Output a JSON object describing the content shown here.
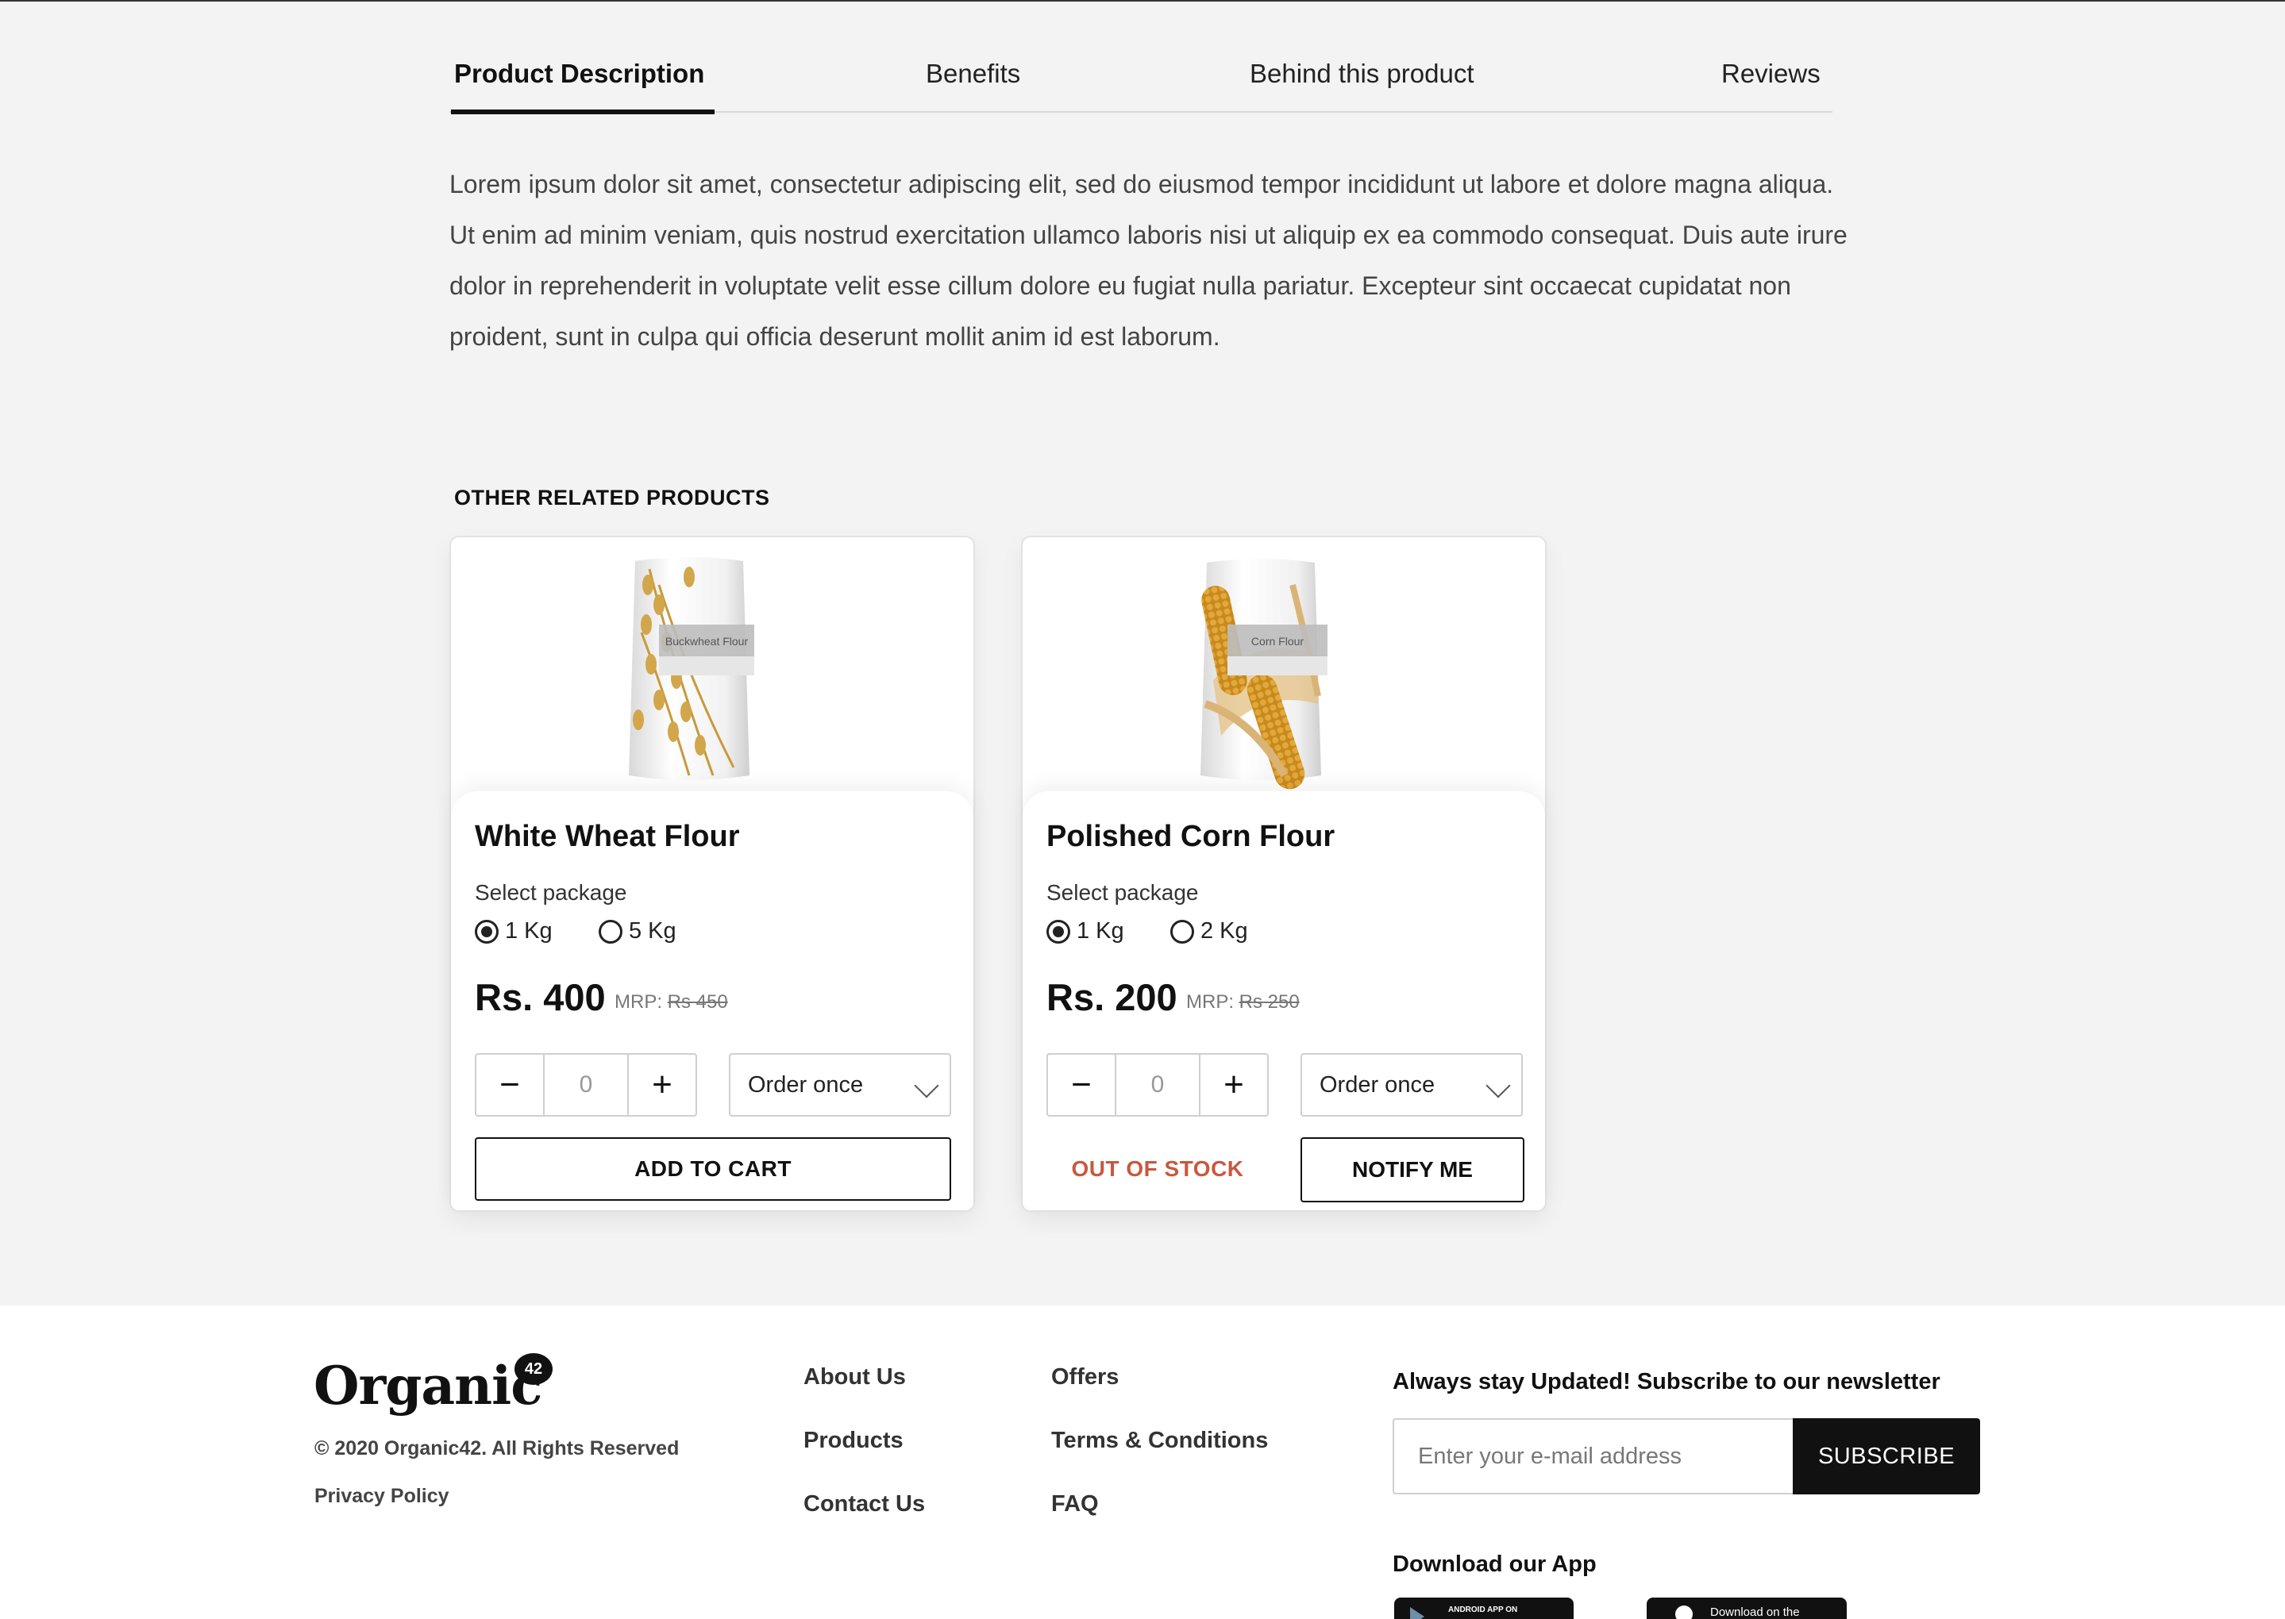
{
  "tabs": {
    "items": [
      "Product Description",
      "Benefits",
      "Behind this product",
      "Reviews"
    ],
    "active": "Product Description"
  },
  "description": "Lorem ipsum dolor sit amet, consectetur adipiscing elit, sed do eiusmod tempor incididunt ut labore et dolore magna aliqua. Ut enim ad minim veniam, quis nostrud exercitation ullamco laboris nisi ut aliquip ex ea commodo consequat. Duis aute irure dolor in reprehenderit in voluptate velit esse cillum dolore eu fugiat nulla pariatur. Excepteur sint occaecat cupidatat non proident, sunt in culpa qui officia deserunt mollit anim id est laborum.",
  "related": {
    "title": "OTHER RELATED PRODUCTS",
    "products": [
      {
        "name": "White Wheat Flour",
        "bag_label": "Buckwheat Flour",
        "select_label": "Select package",
        "options": [
          "1 Kg",
          "5 Kg"
        ],
        "selected": "1 Kg",
        "price": "Rs. 400",
        "mrp_label": "MRP:",
        "mrp_value": "Rs 450",
        "quantity": "0",
        "minus": "−",
        "plus": "+",
        "order_frequency": "Order once",
        "action": "ADD TO CART"
      },
      {
        "name": "Polished Corn Flour",
        "bag_label": "Corn Flour",
        "select_label": "Select package",
        "options": [
          "1 Kg",
          "2 Kg"
        ],
        "selected": "1 Kg",
        "price": "Rs. 200",
        "mrp_label": "MRP:",
        "mrp_value": "Rs 250",
        "quantity": "0",
        "minus": "−",
        "plus": "+",
        "order_frequency": "Order once",
        "stock_status": "OUT OF STOCK",
        "action": "NOTIFY ME"
      }
    ]
  },
  "footer": {
    "logo": "Organic",
    "logo_badge": "42",
    "copyright": "© 2020 Organic42. All Rights Reserved",
    "privacy": "Privacy Policy",
    "links_col1": [
      "About Us",
      "Products",
      "Contact Us"
    ],
    "links_col2": [
      "Offers",
      "Terms & Conditions",
      "FAQ"
    ],
    "newsletter_title": "Always stay Updated! Subscribe to our newsletter",
    "email_placeholder": "Enter your e-mail address",
    "subscribe": "SUBSCRIBE",
    "app_title": "Download our App",
    "app_badges": [
      "ANDROID APP ON",
      "Download on the"
    ]
  },
  "colors": {
    "background": "#f3f3f3",
    "text": "#111111",
    "out_of_stock": "#c9583f",
    "button_dark": "#111111"
  },
  "icons": [
    "minus-icon",
    "plus-icon",
    "chevron-down-icon",
    "play-store-icon",
    "apple-icon"
  ]
}
